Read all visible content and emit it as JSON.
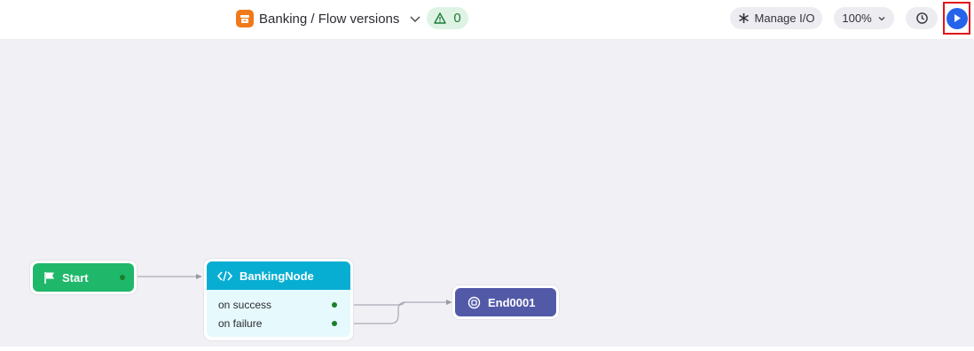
{
  "header": {
    "flow_title": "Banking / Flow versions",
    "warnings_count": "0",
    "manage_io_label": "Manage I/O",
    "zoom_label": "100%"
  },
  "nodes": {
    "start": {
      "label": "Start"
    },
    "banking": {
      "label": "BankingNode",
      "branches": [
        "on success",
        "on failure"
      ]
    },
    "end": {
      "label": "End0001"
    }
  },
  "colors": {
    "start": "#1fb86a",
    "banking": "#08aed2",
    "end": "#525aa8",
    "run_button": "#2563eb",
    "highlight": "#e0121a"
  },
  "icons": {
    "flow": "package-icon",
    "warning": "warning-triangle-icon",
    "manage_io": "asterisk-icon",
    "history": "history-clock-icon",
    "run": "play-icon",
    "start": "flag-icon",
    "banking": "code-icon",
    "end": "stop-circle-icon"
  }
}
